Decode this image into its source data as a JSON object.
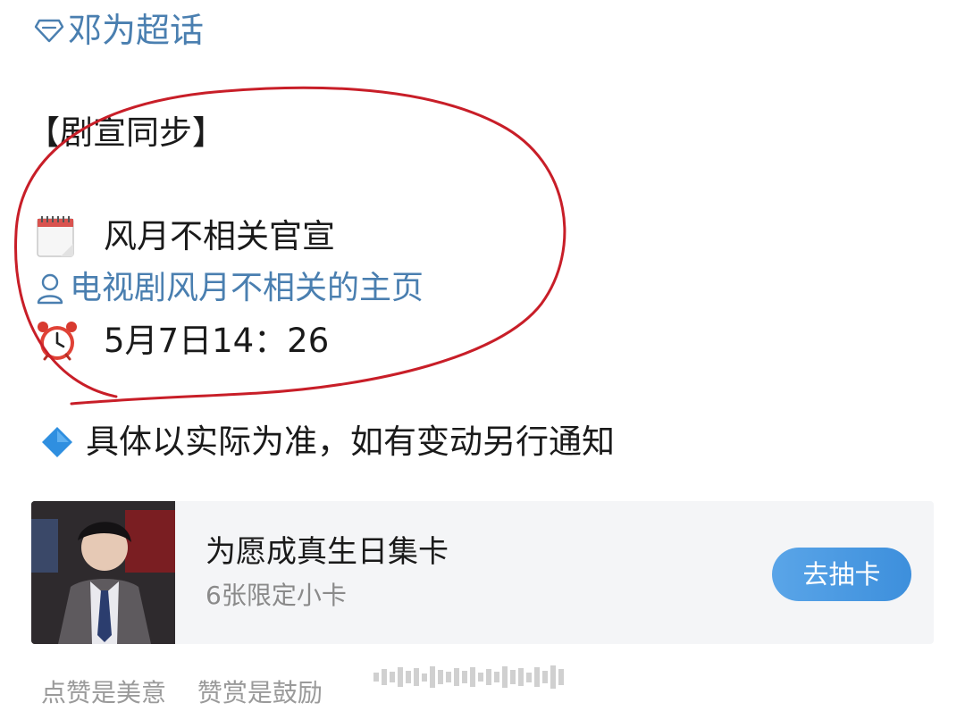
{
  "supertopic": {
    "label": "邓为超话",
    "icon": "diamond-outline-icon",
    "color": "#4a7fb0"
  },
  "post": {
    "heading": "【剧宣同步】",
    "announcement": {
      "icon": "calendar-icon",
      "text": "风月不相关官宣"
    },
    "account_link": {
      "icon": "person-outline-icon",
      "text": "电视剧风月不相关的主页"
    },
    "time": {
      "icon": "alarm-clock-icon",
      "text": "5月7日14：26"
    },
    "note": {
      "icon": "blue-diamond-icon",
      "text": "具体以实际为准，如有变动另行通知"
    },
    "annotation_color": "#c81e28"
  },
  "card": {
    "title": "为愿成真生日集卡",
    "subtitle": "6张限定小卡",
    "button_label": "去抽卡",
    "button_color": "#4a9ae2"
  },
  "footer": {
    "items": [
      "点赞是美意",
      "赞赏是鼓励"
    ]
  }
}
